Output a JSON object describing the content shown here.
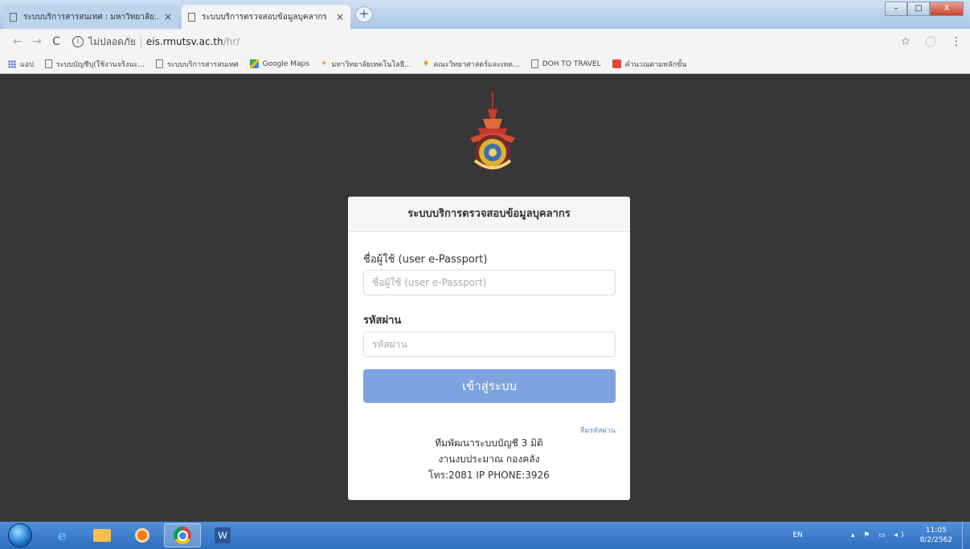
{
  "browser": {
    "tabs": [
      {
        "label": "ระบบบริการสารสนเทศ : มหาวิทยาลัย...",
        "active": false
      },
      {
        "label": "ระบบบริการตรวจสอบข้อมูลบุคลากร",
        "active": true
      }
    ],
    "tab_close_glyph": "×",
    "new_tab_glyph": "+",
    "window_controls": {
      "minimize": "–",
      "maximize": "□",
      "close": "X"
    },
    "address": {
      "security_label": "ไม่ปลอดภัย",
      "host": "eis.rmutsv.ac.th",
      "path": "/hr/"
    },
    "bookmarks": [
      {
        "label": "แอป",
        "icon": "apps-icon"
      },
      {
        "label": "ระบบบัญชีบุ(ใช้งานจริงนะ...",
        "icon": "page-icon"
      },
      {
        "label": "ระบบบริการสารสนเทศ",
        "icon": "page-icon"
      },
      {
        "label": "Google Maps",
        "icon": "maps-icon"
      },
      {
        "label": "มหาวิทยาลัยเทคโนโลยี...",
        "icon": "star-icon"
      },
      {
        "label": "คณะวิทยาศาสตร์และเทค...",
        "icon": "logo-icon"
      },
      {
        "label": "DOH TO TRAVEL",
        "icon": "page-icon"
      },
      {
        "label": "คำนวณตามหลักขั้น",
        "icon": "red-icon"
      }
    ]
  },
  "login": {
    "title": "ระบบบริการตรวจสอบข้อมูลบุคลากร",
    "username_label": "ชื่อผู้ใช้ (user e-Passport)",
    "username_placeholder": "ชื่อผู้ใช้ (user e-Passport)",
    "password_label": "รหัสผ่าน",
    "password_placeholder": "รหัสผ่าน",
    "submit_label": "เข้าสู่ระบบ",
    "forgot_label": "ลืมรหัสผ่าน",
    "footer_line1": "ทีมพัฒนาระบบบัญชี 3 มิติ",
    "footer_line2": "งานงบประมาณ กองคลัง",
    "footer_line3": "โทร:2081 IP PHONE:3926"
  },
  "taskbar": {
    "ie_glyph": "e",
    "word_glyph": "W",
    "language": "EN",
    "time": "11:05",
    "date": "8/2/2562"
  },
  "colors": {
    "page_bg": "#373737",
    "button": "#7ea3df",
    "link": "#5b86c6"
  }
}
